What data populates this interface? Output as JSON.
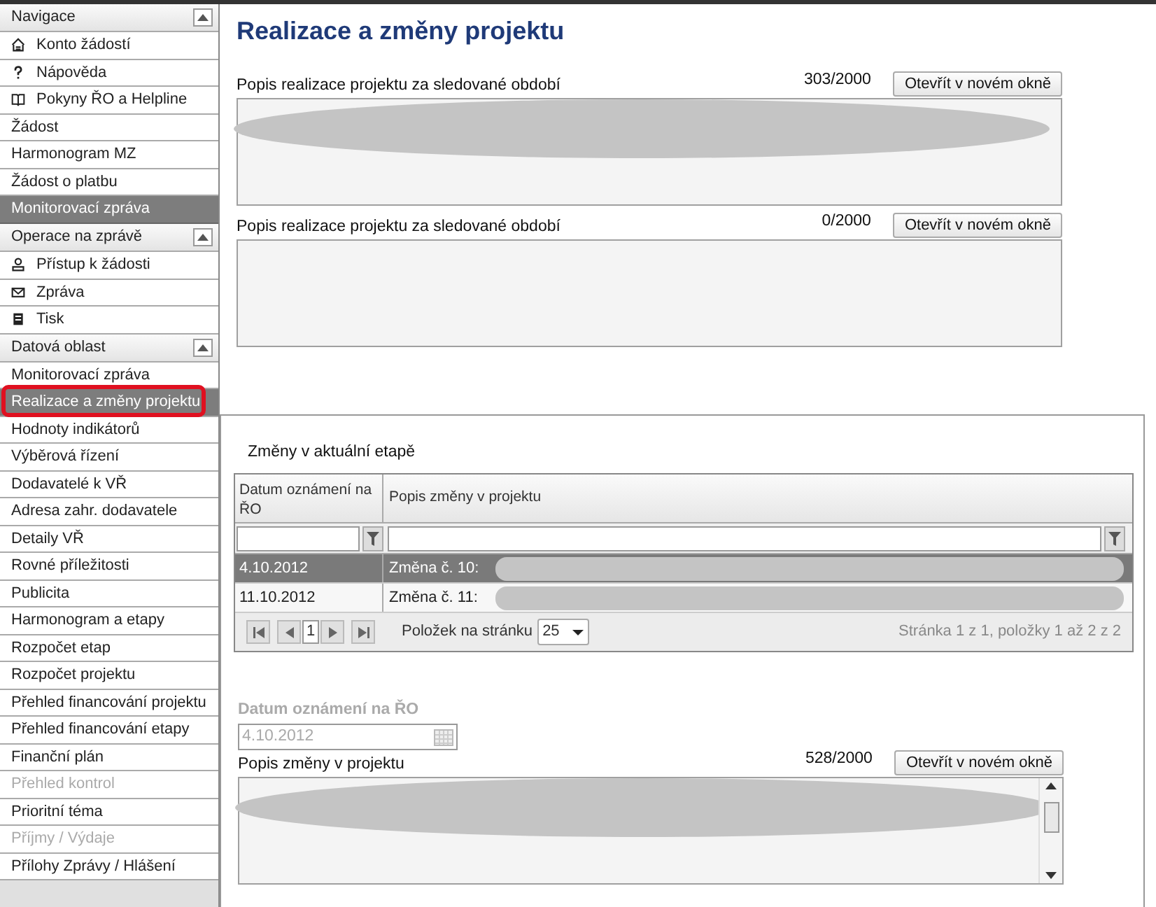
{
  "sidebar": {
    "items": [
      {
        "kind": "header",
        "label": "Navigace",
        "expanded": true
      },
      {
        "kind": "item",
        "label": "Konto žádostí",
        "icon": true,
        "selected": false,
        "disabled": false
      },
      {
        "kind": "item",
        "label": "Nápověda",
        "icon": true,
        "selected": false,
        "disabled": false
      },
      {
        "kind": "item",
        "label": "Pokyny ŘO a Helpline",
        "icon": true,
        "selected": false,
        "disabled": false
      },
      {
        "kind": "item",
        "label": "Žádost",
        "selected": false,
        "disabled": false
      },
      {
        "kind": "item",
        "label": "Harmonogram MZ",
        "selected": false,
        "disabled": false
      },
      {
        "kind": "item",
        "label": "Žádost o platbu",
        "selected": false,
        "disabled": false
      },
      {
        "kind": "band",
        "label": "Monitorovací zpráva"
      },
      {
        "kind": "header",
        "label": "Operace na zprávě",
        "expanded": true
      },
      {
        "kind": "item",
        "label": "Přístup k žádosti",
        "icon": true,
        "selected": false,
        "disabled": false
      },
      {
        "kind": "item",
        "label": "Zpráva",
        "icon": true,
        "selected": false,
        "disabled": false
      },
      {
        "kind": "item",
        "label": "Tisk",
        "icon": true,
        "selected": false,
        "disabled": false
      },
      {
        "kind": "header",
        "label": "Datová oblast",
        "expanded": true
      },
      {
        "kind": "item",
        "label": "Monitorovací zpráva",
        "selected": false,
        "disabled": false
      },
      {
        "kind": "item",
        "label": "Realizace a změny projektu",
        "selected": true,
        "disabled": false,
        "highlighted": true
      },
      {
        "kind": "item",
        "label": "Hodnoty indikátorů",
        "selected": false,
        "disabled": false
      },
      {
        "kind": "item",
        "label": "Výběrová řízení",
        "selected": false,
        "disabled": false
      },
      {
        "kind": "item",
        "label": "Dodavatelé k VŘ",
        "selected": false,
        "disabled": false
      },
      {
        "kind": "item",
        "label": "Adresa zahr. dodavatele",
        "selected": false,
        "disabled": false
      },
      {
        "kind": "item",
        "label": "Detaily VŘ",
        "selected": false,
        "disabled": false
      },
      {
        "kind": "item",
        "label": "Rovné příležitosti",
        "selected": false,
        "disabled": false
      },
      {
        "kind": "item",
        "label": "Publicita",
        "selected": false,
        "disabled": false
      },
      {
        "kind": "item",
        "label": "Harmonogram a etapy",
        "selected": false,
        "disabled": false
      },
      {
        "kind": "item",
        "label": "Rozpočet etap",
        "selected": false,
        "disabled": false
      },
      {
        "kind": "item",
        "label": "Rozpočet projektu",
        "selected": false,
        "disabled": false
      },
      {
        "kind": "item",
        "label": "Přehled financování projektu",
        "selected": false,
        "disabled": false
      },
      {
        "kind": "item",
        "label": "Přehled financování etapy",
        "selected": false,
        "disabled": false
      },
      {
        "kind": "item",
        "label": "Finanční plán",
        "selected": false,
        "disabled": false
      },
      {
        "kind": "item",
        "label": "Přehled kontrol",
        "selected": false,
        "disabled": true
      },
      {
        "kind": "item",
        "label": "Prioritní téma",
        "selected": false,
        "disabled": false
      },
      {
        "kind": "item",
        "label": "Příjmy / Výdaje",
        "selected": false,
        "disabled": true
      },
      {
        "kind": "item",
        "label": "Přílohy Zprávy / Hlášení",
        "selected": false,
        "disabled": false
      }
    ]
  },
  "page_title": "Realizace a změny projektu",
  "text_sections": [
    {
      "label": "Popis realizace projektu za sledované období",
      "counter": "303/2000",
      "button": "Otevřít v novém okně",
      "redacted": true
    },
    {
      "label": "Popis realizace projektu za sledované období",
      "counter": "0/2000",
      "button": "Otevřít v novém okně",
      "redacted": false
    }
  ],
  "changes": {
    "title": "Změny v aktuální etapě",
    "columns": [
      "Datum oznámení na ŘO",
      "Popis změny v projektu"
    ],
    "rows": [
      {
        "date": "4.10.2012",
        "description": "Změna č. 10:",
        "selected": true
      },
      {
        "date": "11.10.2012",
        "description": "Změna č. 11:",
        "selected": false
      }
    ],
    "pager": {
      "page": "1",
      "page_size_label": "Položek na stránku",
      "page_size": "25",
      "summary": "Stránka 1 z 1, položky 1 až 2 z 2"
    }
  },
  "detail": {
    "date_label": "Datum oznámení na ŘO",
    "date_value": "4.10.2012",
    "disabled": true,
    "description_label": "Popis změny v projektu",
    "counter": "528/2000",
    "button": "Otevřít v novém okně",
    "redacted": true
  }
}
